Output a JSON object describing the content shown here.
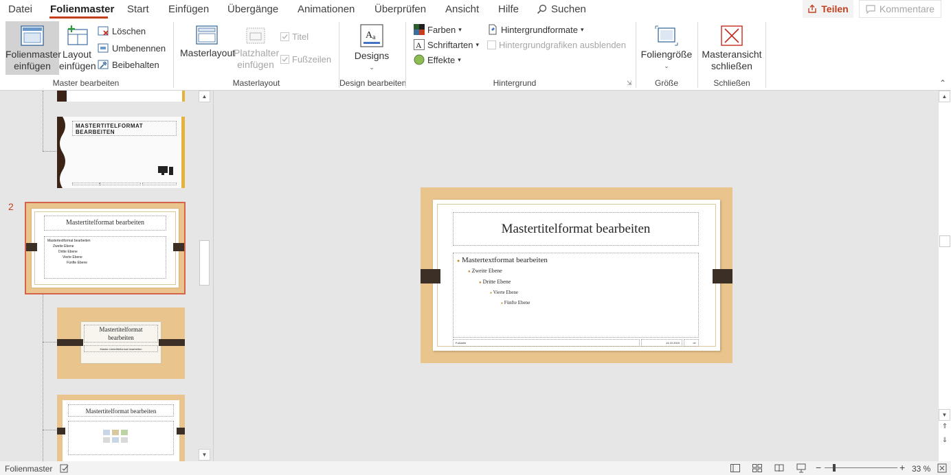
{
  "menu": {
    "tabs": [
      "Datei",
      "Folienmaster",
      "Start",
      "Einfügen",
      "Übergänge",
      "Animationen",
      "Überprüfen",
      "Ansicht",
      "Hilfe"
    ],
    "search": "Suchen",
    "share": "Teilen",
    "comment": "Kommentare"
  },
  "ribbon": {
    "master_bearbeiten": {
      "label": "Master bearbeiten",
      "insert_master": [
        "Folienmaster",
        "einfügen"
      ],
      "insert_layout": [
        "Layout",
        "einfügen"
      ],
      "delete": "Löschen",
      "rename": "Umbenennen",
      "keep": "Beibehalten"
    },
    "masterlayout": {
      "label": "Masterlayout",
      "masterlayout_btn": "Masterlayout",
      "placeholder": [
        "Platzhalter",
        "einfügen"
      ],
      "title_chk": "Titel",
      "footer_chk": "Fußzeilen"
    },
    "design": {
      "label": "Design bearbeiten",
      "designs": "Designs"
    },
    "hintergrund": {
      "label": "Hintergrund",
      "colors": "Farben",
      "fonts": "Schriftarten",
      "effects": "Effekte",
      "bg_formats": "Hintergrundformate",
      "hide_bg": "Hintergrundgrafiken ausblenden"
    },
    "groesse": {
      "label": "Größe",
      "slide_size": "Foliengröße"
    },
    "schliessen": {
      "label": "Schließen",
      "close_master": [
        "Masteransicht",
        "schließen"
      ]
    }
  },
  "thumbnails": {
    "slide_number": "2",
    "t1_title": "MASTERTITELFORMAT BEARBEITEN",
    "t2_title": "Mastertitelformat bearbeiten",
    "t2_body": "Mastertextformat bearbeiten",
    "t2_lvl2": "Zweite Ebene",
    "t2_lvl3": "Dritte Ebene",
    "t2_lvl4": "Vierte Ebene",
    "t2_lvl5": "Fünfte Ebene",
    "t3_title": [
      "Mastertitelformat",
      "bearbeiten"
    ],
    "t3_sub": "Master-Untertitelformat bearbeiten",
    "t4_title": "Mastertitelformat bearbeiten"
  },
  "slide": {
    "title": "Mastertitelformat bearbeiten",
    "body": "Mastertextformat bearbeiten",
    "levels": [
      "Zweite Ebene",
      "Dritte Ebene",
      "Vierte Ebene",
      "Fünfte Ebene"
    ],
    "footer": "Fußzeile",
    "date": "14.10.2019",
    "page": "‹#›"
  },
  "status": {
    "mode": "Folienmaster",
    "zoom": "33 %"
  },
  "colors": {
    "accent": "#c43e1c",
    "wood": "#e9c48d",
    "dark_band": "#3b2f26"
  }
}
